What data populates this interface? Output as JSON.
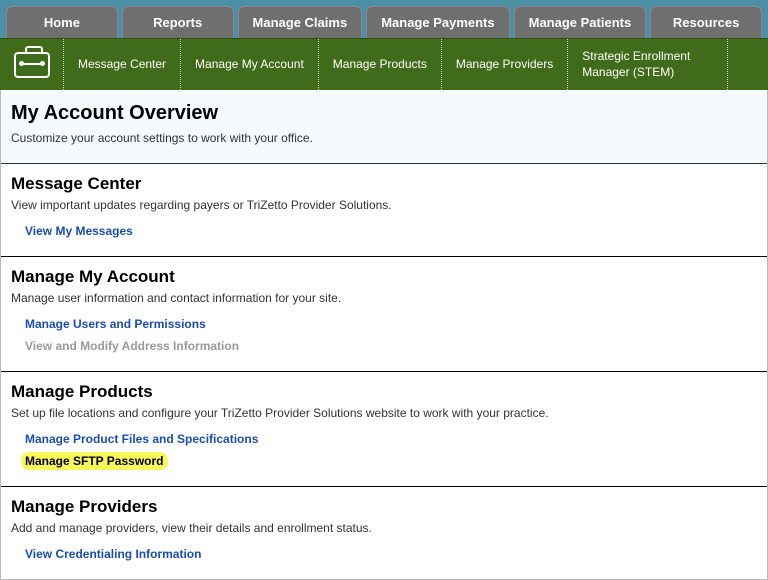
{
  "topnav": {
    "items": [
      {
        "label": "Home"
      },
      {
        "label": "Reports"
      },
      {
        "label": "Manage Claims"
      },
      {
        "label": "Manage Payments"
      },
      {
        "label": "Manage Patients"
      },
      {
        "label": "Resources"
      }
    ]
  },
  "subnav": {
    "items": [
      {
        "label": "Message Center"
      },
      {
        "label": "Manage My Account"
      },
      {
        "label": "Manage Products"
      },
      {
        "label": "Manage Providers"
      },
      {
        "label": "Strategic Enrollment Manager (STEM)"
      }
    ]
  },
  "intro": {
    "title": "My Account Overview",
    "subtitle": "Customize your account settings to work with your office."
  },
  "sections": [
    {
      "title": "Message Center",
      "desc": "View important updates regarding payers or TriZetto Provider Solutions.",
      "links": [
        {
          "label": "View My Messages",
          "type": "link"
        }
      ]
    },
    {
      "title": "Manage My Account",
      "desc": "Manage user information and contact information for your site.",
      "links": [
        {
          "label": "Manage Users and Permissions",
          "type": "link"
        },
        {
          "label": "View and Modify Address Information",
          "type": "disabled"
        }
      ]
    },
    {
      "title": "Manage Products",
      "desc": "Set up file locations and configure your TriZetto Provider Solutions website to work with your practice.",
      "links": [
        {
          "label": "Manage Product Files and Specifications",
          "type": "link"
        },
        {
          "label": "Manage SFTP Password",
          "type": "highlight"
        }
      ]
    },
    {
      "title": "Manage Providers",
      "desc": "Add and manage providers, view their details and enrollment status.",
      "links": [
        {
          "label": "View Credentialing Information",
          "type": "link"
        }
      ]
    }
  ]
}
